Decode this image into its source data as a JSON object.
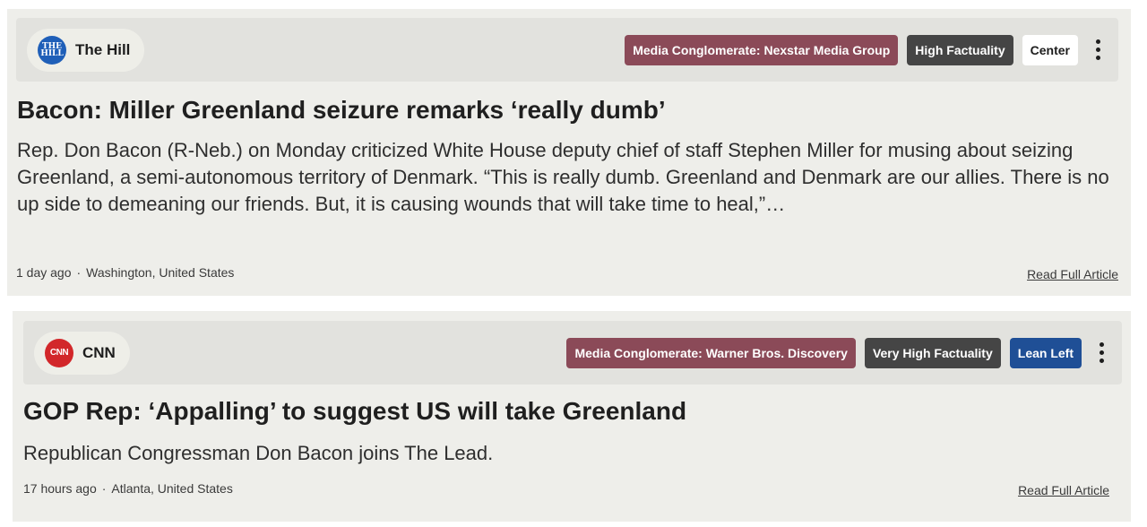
{
  "articles": [
    {
      "source": {
        "name": "The Hill",
        "logo_icon": "the-hill-logo",
        "logo_text": "THE HILL"
      },
      "badges": {
        "owner": "Media Conglomerate: Nexstar Media Group",
        "factuality": "High Factuality",
        "bias": "Center"
      },
      "headline": "Bacon: Miller Greenland seizure remarks ‘really dumb’",
      "summary": "Rep. Don Bacon (R-Neb.) on Monday criticized White House deputy chief of staff Stephen Miller for musing about seizing Greenland, a semi-autonomous territory of Denmark. “This is really dumb. Greenland and Denmark are our allies. There is no up side to demeaning our friends. But, it is causing wounds that will take time to heal,”…",
      "time": "1 day ago",
      "separator": "·",
      "location": "Washington, United States",
      "read_more": "Read Full Article"
    },
    {
      "source": {
        "name": "CNN",
        "logo_icon": "cnn-logo",
        "logo_text": "CNN"
      },
      "badges": {
        "owner": "Media Conglomerate: Warner Bros. Discovery",
        "factuality": "Very High Factuality",
        "bias": "Lean Left"
      },
      "headline": "GOP Rep: ‘Appalling’ to suggest US will take Greenland",
      "summary": "Republican Congressman Don Bacon joins The Lead.",
      "time": "17 hours ago",
      "separator": "·",
      "location": "Atlanta, United States",
      "read_more": "Read Full Article"
    }
  ],
  "colors": {
    "card_bg": "#eeeeea",
    "owner_badge": "#8b4a58",
    "factuality_badge": "#454545",
    "center_badge": "#ffffff",
    "lean_left_badge": "#1f4f96"
  },
  "icons": {
    "menu": "kebab-menu-icon"
  }
}
